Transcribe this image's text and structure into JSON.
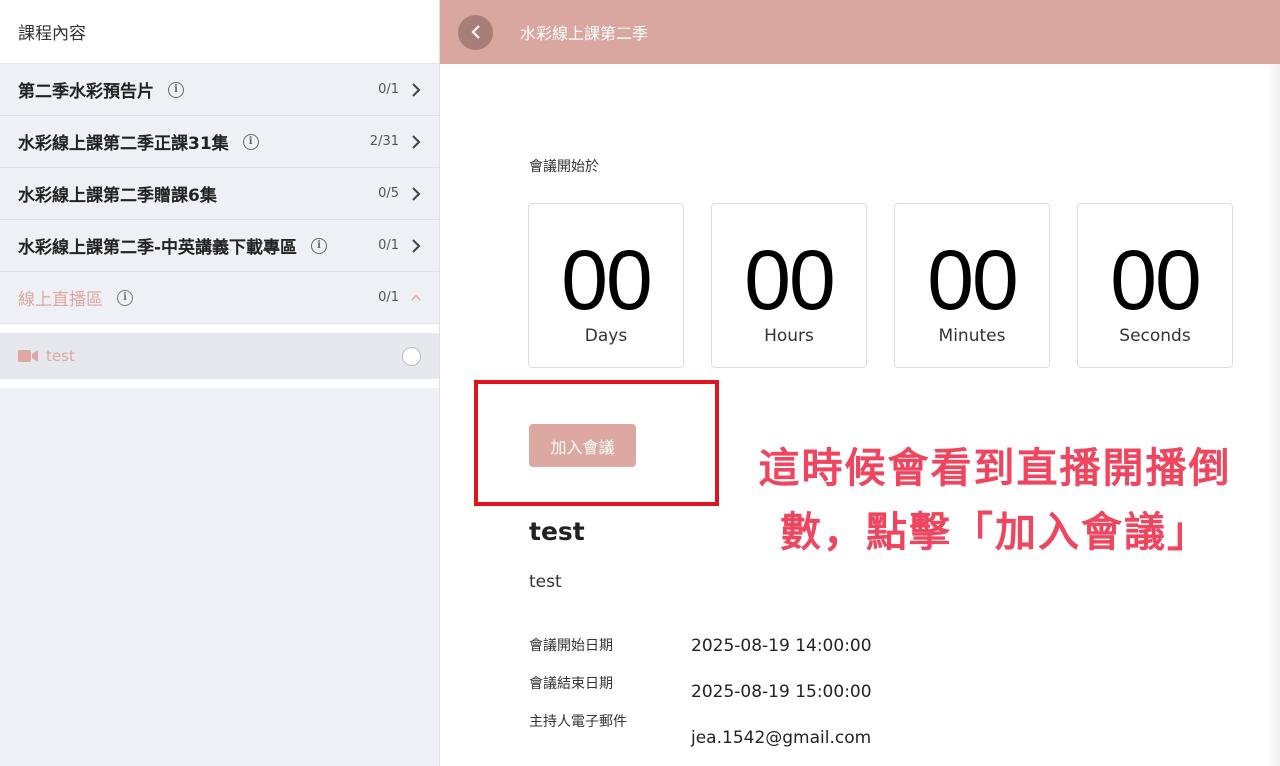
{
  "sidebar": {
    "header": "課程內容",
    "sections": [
      {
        "title": "第二季水彩預告片",
        "count": "0/1"
      },
      {
        "title": "水彩線上課第二季正課31集",
        "count": "2/31"
      },
      {
        "title": "水彩線上課第二季贈課6集",
        "count": "0/5"
      },
      {
        "title": "水彩線上課第二季-中英講義下載專區",
        "count": "0/1"
      },
      {
        "title": "線上直播區",
        "count": "0/1"
      }
    ],
    "info_glyph": "i",
    "lesson": {
      "title": "test"
    }
  },
  "topbar": {
    "title": "水彩線上課第二季"
  },
  "countdown": {
    "label": "會議開始於",
    "days": "00",
    "days_label": "Days",
    "hours": "00",
    "hours_label": "Hours",
    "minutes": "00",
    "minutes_label": "Minutes",
    "seconds": "00",
    "seconds_label": "Seconds"
  },
  "join_button": "加入會議",
  "annotation": {
    "line1": "這時候會看到直播開播倒",
    "line2": "數，點擊「加入會議」"
  },
  "meeting": {
    "title": "test",
    "description": "test",
    "start_label": "會議開始日期",
    "start_value": "2025-08-19 14:00:00",
    "end_label": "會議結束日期",
    "end_value": "2025-08-19 15:00:00",
    "host_label": "主持人電子郵件",
    "host_value": "jea.1542@gmail.com"
  },
  "colors": {
    "accent": "#d9a6a0",
    "accent_text": "#dca8a1",
    "annotation": "#f0455f",
    "highlight": "#e0141e"
  },
  "icons": [
    "back-arrow-icon",
    "info-icon",
    "chevron-right-icon",
    "chevron-up-icon",
    "video-camera-icon",
    "radio-circle-icon"
  ]
}
